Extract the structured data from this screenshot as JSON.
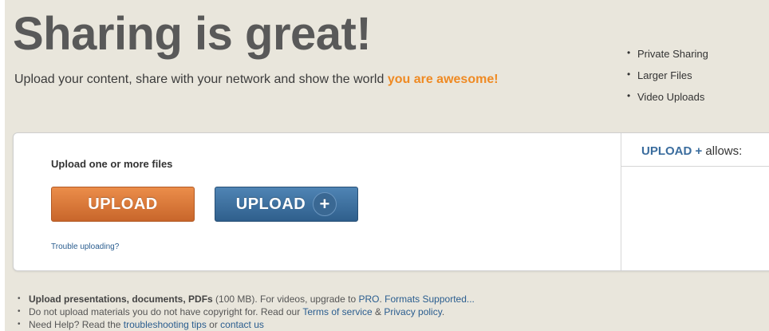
{
  "header": {
    "headline": "Sharing is great!",
    "subline_prefix": "Upload your content, share with your network and show the world ",
    "subline_highlight": "you are awesome!"
  },
  "upload_panel": {
    "title": "Upload one or more files",
    "upload_button": "UPLOAD",
    "upload_plus_button": "UPLOAD",
    "plus_symbol": "+",
    "trouble_link": "Trouble uploading?"
  },
  "allows": {
    "brand": "UPLOAD +",
    "suffix": " allows:",
    "items": [
      "Private Sharing",
      "Larger Files",
      "Video Uploads"
    ]
  },
  "notes": {
    "line1": {
      "bold": "Upload presentations, documents, PDFs",
      "text1": " (100 MB). For videos, upgrade to ",
      "link_pro": "PRO",
      "text2": ". ",
      "link_formats": "Formats Supported..."
    },
    "line2": {
      "text1": "Do not upload materials you do not have copyright for. Read our ",
      "link_terms": "Terms of service",
      "text2": " & ",
      "link_privacy": "Privacy policy",
      "text3": "."
    },
    "line3": {
      "text1": "Need Help? Read the ",
      "link_tips": "troubleshooting tips",
      "text2": " or ",
      "link_contact": "contact us"
    }
  },
  "colors": {
    "background": "#e9e6dc",
    "highlight_orange": "#ef8a23",
    "upload_orange": "#d8753a",
    "upload_blue": "#3a6c9c",
    "link_blue": "#2a5d8f"
  }
}
